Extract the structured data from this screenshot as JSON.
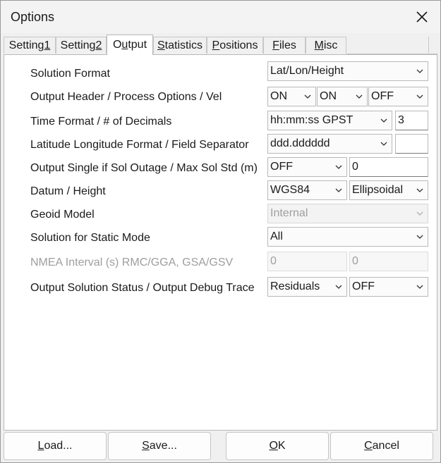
{
  "window": {
    "title": "Options"
  },
  "tabs": [
    {
      "label": "Setting1",
      "mnemonic_index": 7
    },
    {
      "label": "Setting2",
      "mnemonic_index": 7
    },
    {
      "label": "Output",
      "mnemonic_index": 1
    },
    {
      "label": "Statistics",
      "mnemonic_index": 0
    },
    {
      "label": "Positions",
      "mnemonic_index": 0
    },
    {
      "label": "Files",
      "mnemonic_index": 0
    },
    {
      "label": "Misc",
      "mnemonic_index": 0
    }
  ],
  "active_tab": "Output",
  "rows": {
    "solution_format": {
      "label": "Solution Format",
      "value": "Lat/Lon/Height"
    },
    "output_header": {
      "label": "Output Header / Process Options / Vel",
      "header": "ON",
      "process_options": "ON",
      "velocity": "OFF"
    },
    "time_format": {
      "label": "Time Format / # of Decimals",
      "format": "hh:mm:ss GPST",
      "decimals": "3"
    },
    "latlon_format": {
      "label": "Latitude Longitude Format / Field Separator",
      "format": "ddd.dddddd",
      "separator": ""
    },
    "sol_outage": {
      "label": "Output Single if Sol Outage / Max Sol Std (m)",
      "single": "OFF",
      "max_std": "0"
    },
    "datum": {
      "label": "Datum / Height",
      "datum": "WGS84",
      "height": "Ellipsoidal"
    },
    "geoid": {
      "label": "Geoid Model",
      "value": "Internal"
    },
    "static_mode": {
      "label": "Solution for Static Mode",
      "value": "All"
    },
    "nmea": {
      "label": "NMEA Interval (s) RMC/GGA, GSA/GSV",
      "rmc_gga": "0",
      "gsa_gsv": "0"
    },
    "status": {
      "label": "Output Solution Status / Output Debug Trace",
      "solution_status": "Residuals",
      "debug_trace": "OFF"
    }
  },
  "buttons": {
    "load": "Load...",
    "save": "Save...",
    "ok": "OK",
    "cancel": "Cancel"
  },
  "icons": {
    "close": "close-icon",
    "dropdown": "chevron-down-icon"
  }
}
